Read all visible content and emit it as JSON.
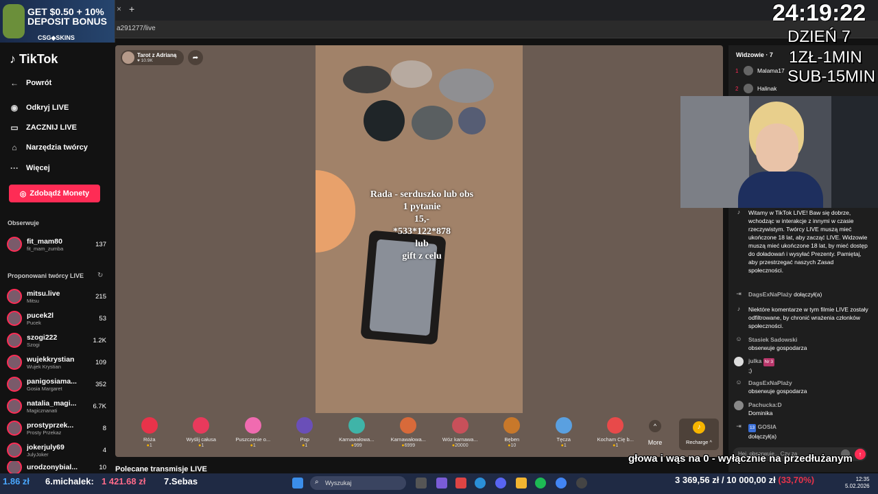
{
  "browser": {
    "url": "a291277/live",
    "new_tab": "+",
    "close_tab": "×"
  },
  "ad": {
    "title": "GET $0.50 + 10% DEPOSIT BONUS",
    "brand": "CSG◆SKINS"
  },
  "sidebar": {
    "logo": "TikTok",
    "nav": [
      {
        "label": "Powrót",
        "icon": "←"
      },
      {
        "label": "Odkryj LIVE",
        "icon": "◉"
      },
      {
        "label": "ZACZNIJ LIVE",
        "icon": "▭"
      },
      {
        "label": "Narzędzia twórcy",
        "icon": "⌂"
      },
      {
        "label": "Więcej",
        "icon": "···"
      }
    ],
    "coins_button": "Zdobądź Monety",
    "following_title": "Obserwuje",
    "following": [
      {
        "name": "fit_mam80",
        "sub": "fit_mam_zumba",
        "count": "137"
      }
    ],
    "suggested_title": "Proponowani twórcy LIVE",
    "suggested": [
      {
        "name": "mitsu.live",
        "sub": "Mitsu",
        "count": "215"
      },
      {
        "name": "pucek2l",
        "sub": "Pucek",
        "count": "53"
      },
      {
        "name": "szogi222",
        "sub": "Szogi",
        "count": "1.2K"
      },
      {
        "name": "wujekkrystian",
        "sub": "Wujek Krystian",
        "count": "109"
      },
      {
        "name": "panigosiama...",
        "sub": "Gosia Margaret",
        "count": "352"
      },
      {
        "name": "natalia_magi...",
        "sub": "Magicznanati",
        "count": "6.7K"
      },
      {
        "name": "prostyprzek...",
        "sub": "Prosty Przekaz",
        "count": "8"
      },
      {
        "name": "jokerjuly69",
        "sub": "JulyJoker",
        "count": "4"
      },
      {
        "name": "urodzonybial...",
        "sub": "",
        "count": "10"
      }
    ]
  },
  "stage": {
    "host_name": "Tarot z Adrianą",
    "host_likes": "♥ 10.9K",
    "overlay_lines": [
      "Rada - serduszko lub obs",
      "1 pytanie",
      "15,-",
      "*533*122*878",
      "lub",
      "gift z celu"
    ],
    "recommended": "Polecane transmisje LIVE"
  },
  "gifts": [
    {
      "label": "Róża",
      "price": "1",
      "color": "#e8334a"
    },
    {
      "label": "Wyślij całusa",
      "price": "1",
      "color": "#e83a5c"
    },
    {
      "label": "Puszczenie o...",
      "price": "1",
      "color": "#f06bb0"
    },
    {
      "label": "Pop",
      "price": "1",
      "color": "#6a4fb8"
    },
    {
      "label": "Karnawałowa...",
      "price": "999",
      "color": "#3fb4a8"
    },
    {
      "label": "Karnawałowa...",
      "price": "6999",
      "color": "#d86a3a"
    },
    {
      "label": "Wóz karnawa...",
      "price": "20000",
      "color": "#c8505a"
    },
    {
      "label": "Bęben",
      "price": "10",
      "color": "#c8782a"
    },
    {
      "label": "Tęcza",
      "price": "1",
      "color": "#5aa0e0"
    },
    {
      "label": "Kocham Cię b...",
      "price": "1",
      "color": "#e84a4a"
    }
  ],
  "gift_more": "More",
  "recharge": "Recharge ^",
  "chat": {
    "viewers_title": "Widzowie · 7",
    "viewers": [
      {
        "rank": "1",
        "name": "Malama17"
      },
      {
        "rank": "2",
        "name": "Halinak"
      }
    ],
    "messages": [
      {
        "user": "",
        "text": "Witamy w TikTok LIVE! Baw się dobrze, wchodząc w interakcje z innymi w czasie rzeczywistym. Twórcy LIVE muszą mieć ukończone 18 lat, aby zacząć LIVE. Widzowie muszą mieć ukończone 18 lat, by mieć dostęp do doładowań i wysyłać Prezenty. Pamiętaj, aby przestrzegać naszych Zasad społeczności."
      },
      {
        "user": "DagsExNaPlaży",
        "text": "dołączył(a)"
      },
      {
        "user": "",
        "text": "Niektóre komentarze w tym filmie LIVE zostały odfiltrowane, by chronić wrażenia członków społeczności."
      },
      {
        "user": "Stasiek Sadowski",
        "text": "obserwuje gospodarza"
      },
      {
        "user": "julka",
        "badge": "Nr 3",
        "text": ";)"
      },
      {
        "user": "DagsExNaPlaży",
        "text": "obserwuje gospodarza"
      },
      {
        "user": "Pachucka:D",
        "text": "Dominika"
      },
      {
        "user": "GOSIA",
        "badge": "13",
        "text": "dołączył(a)"
      }
    ],
    "input_placeholder": "Hej, obserwuję... Czy za"
  },
  "stream_overlay": {
    "timer": "24:19:22",
    "lines": [
      "DZIEŃ 7",
      "1ZŁ-1MIN",
      "SUB-15MIN"
    ],
    "ticker": "głowa i wąs na 0 - wyłącznie na przedłużanym"
  },
  "donations": {
    "left_amount": "1.86 zł",
    "top1_name": "6.michalek:",
    "top1_amount": "1 421.68 zł",
    "top2_name": "7.Sebas",
    "goal_current": "3 369,56 zł",
    "goal_target": "10 000,00 zł",
    "goal_percent": "(33,70%)"
  },
  "taskbar": {
    "search": "Wyszukaj",
    "time": "12:35",
    "date": "5.02.2026"
  },
  "colors": {
    "accent": "#fe2c55",
    "stage": "#6a5b52",
    "chat_bg": "#1e1e1e"
  }
}
